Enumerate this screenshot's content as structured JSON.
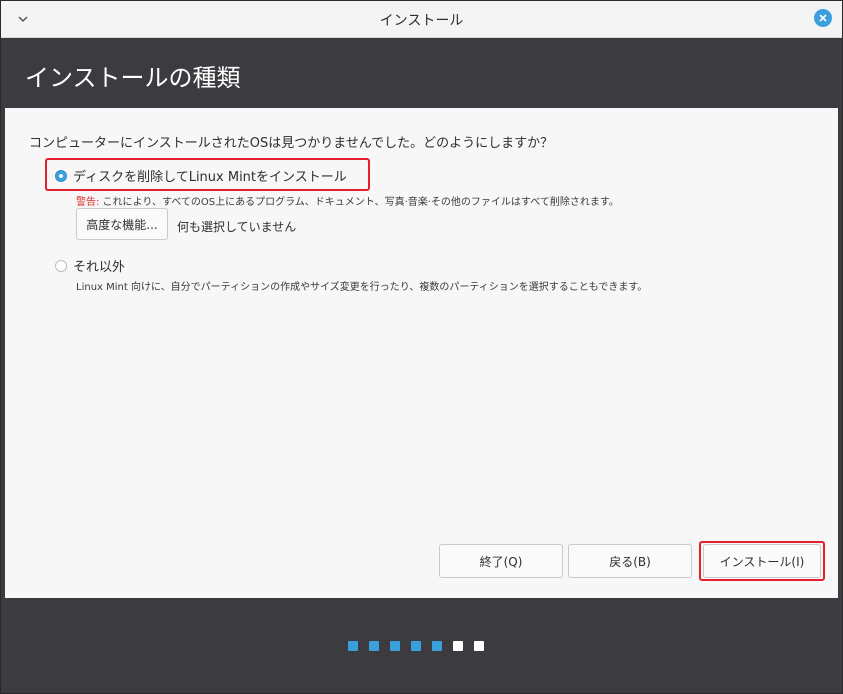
{
  "window": {
    "title": "インストール"
  },
  "header": {
    "page_title": "インストールの種類"
  },
  "main": {
    "question": "コンピューターにインストールされたOSは見つかりませんでした。どのようにしますか？",
    "option_erase": {
      "label": "ディスクを削除してLinux Mintをインストール",
      "selected": true
    },
    "warning_label": "警告:",
    "warning_text": " これにより、すべてのOS上にあるプログラム、ドキュメント、写真·音楽·その他のファイルはすべて削除されます。",
    "advanced_button": "高度な機能...",
    "advanced_status": "何も選択していません",
    "option_other": {
      "label": "それ以外",
      "selected": false
    },
    "other_description": "Linux Mint 向けに、自分でパーティションの作成やサイズ変更を行ったり、複数のパーティションを選択することもできます。"
  },
  "buttons": {
    "quit": "終了(Q)",
    "back": "戻る(B)",
    "install": "インストール(I)"
  },
  "progress": {
    "total_steps": 7,
    "completed_steps": 5,
    "active_color": "#3aa0dd",
    "inactive_color": "#ffffff"
  },
  "colors": {
    "accent": "#3aa0dd",
    "highlight": "#e4202e",
    "warning": "#e02b2b"
  }
}
